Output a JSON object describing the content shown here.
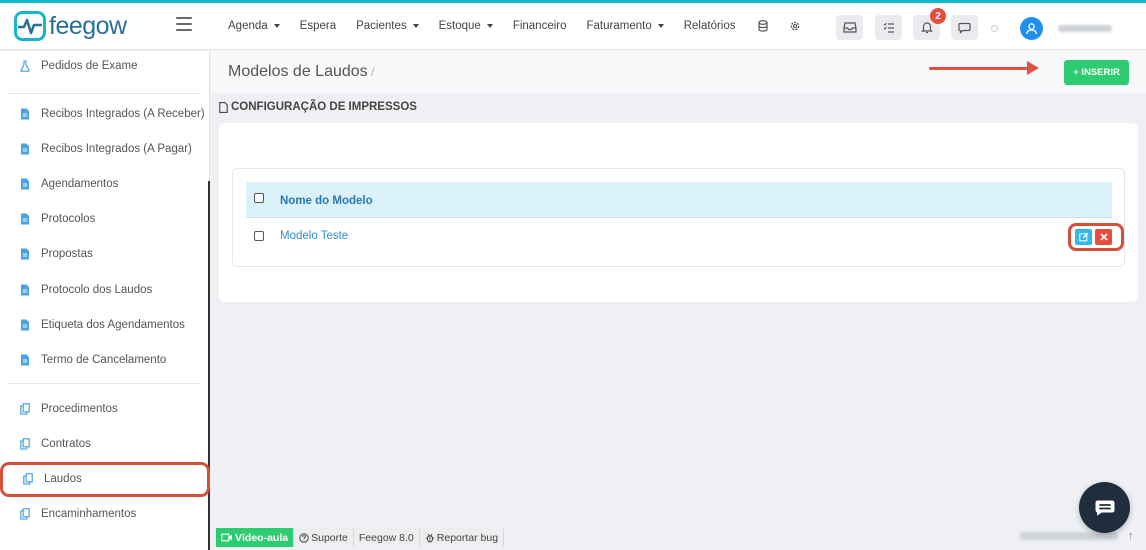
{
  "brand": {
    "name": "feegow"
  },
  "nav": [
    {
      "label": "Agenda",
      "dropdown": true
    },
    {
      "label": "Espera",
      "dropdown": false
    },
    {
      "label": "Pacientes",
      "dropdown": true
    },
    {
      "label": "Estoque",
      "dropdown": true
    },
    {
      "label": "Financeiro",
      "dropdown": false
    },
    {
      "label": "Faturamento",
      "dropdown": true
    },
    {
      "label": "Relatórios",
      "dropdown": false
    }
  ],
  "header": {
    "notifications_count": "2"
  },
  "sidebar": {
    "items": [
      {
        "label": "Pedidos de Exame",
        "icon": "flask-icon"
      },
      {
        "label": "Recibos Integrados (A Receber)",
        "icon": "document-icon"
      },
      {
        "label": "Recibos Integrados (A Pagar)",
        "icon": "document-icon"
      },
      {
        "label": "Agendamentos",
        "icon": "document-icon"
      },
      {
        "label": "Protocolos",
        "icon": "document-icon"
      },
      {
        "label": "Propostas",
        "icon": "document-icon"
      },
      {
        "label": "Protocolo dos Laudos",
        "icon": "document-icon"
      },
      {
        "label": "Etiqueta dos Agendamentos",
        "icon": "document-icon"
      },
      {
        "label": "Termo de Cancelamento",
        "icon": "document-icon"
      },
      {
        "label": "Procedimentos",
        "icon": "copy-icon"
      },
      {
        "label": "Contratos",
        "icon": "copy-icon"
      },
      {
        "label": "Laudos",
        "icon": "copy-icon"
      },
      {
        "label": "Encaminhamentos",
        "icon": "copy-icon"
      }
    ],
    "active": "Laudos"
  },
  "main": {
    "title": "Modelos de Laudos",
    "breadcrumb_sep": "/",
    "insert_label": "+ INSERIR",
    "section_title": "CONFIGURAÇÃO DE IMPRESSOS",
    "table": {
      "header": "Nome do Modelo",
      "rows": [
        {
          "name": "Modelo Teste"
        }
      ]
    }
  },
  "footer": {
    "video": "Vídeo-aula",
    "support": "Suporte",
    "version": "Feegow 8.0",
    "bug": "Reportar bug"
  },
  "colors": {
    "brand_blue": "#2a6f97",
    "accent_green": "#2ecc71",
    "link_blue": "#2d8fd5",
    "danger_red": "#e74c3c",
    "highlight_red": "#d4503a"
  }
}
